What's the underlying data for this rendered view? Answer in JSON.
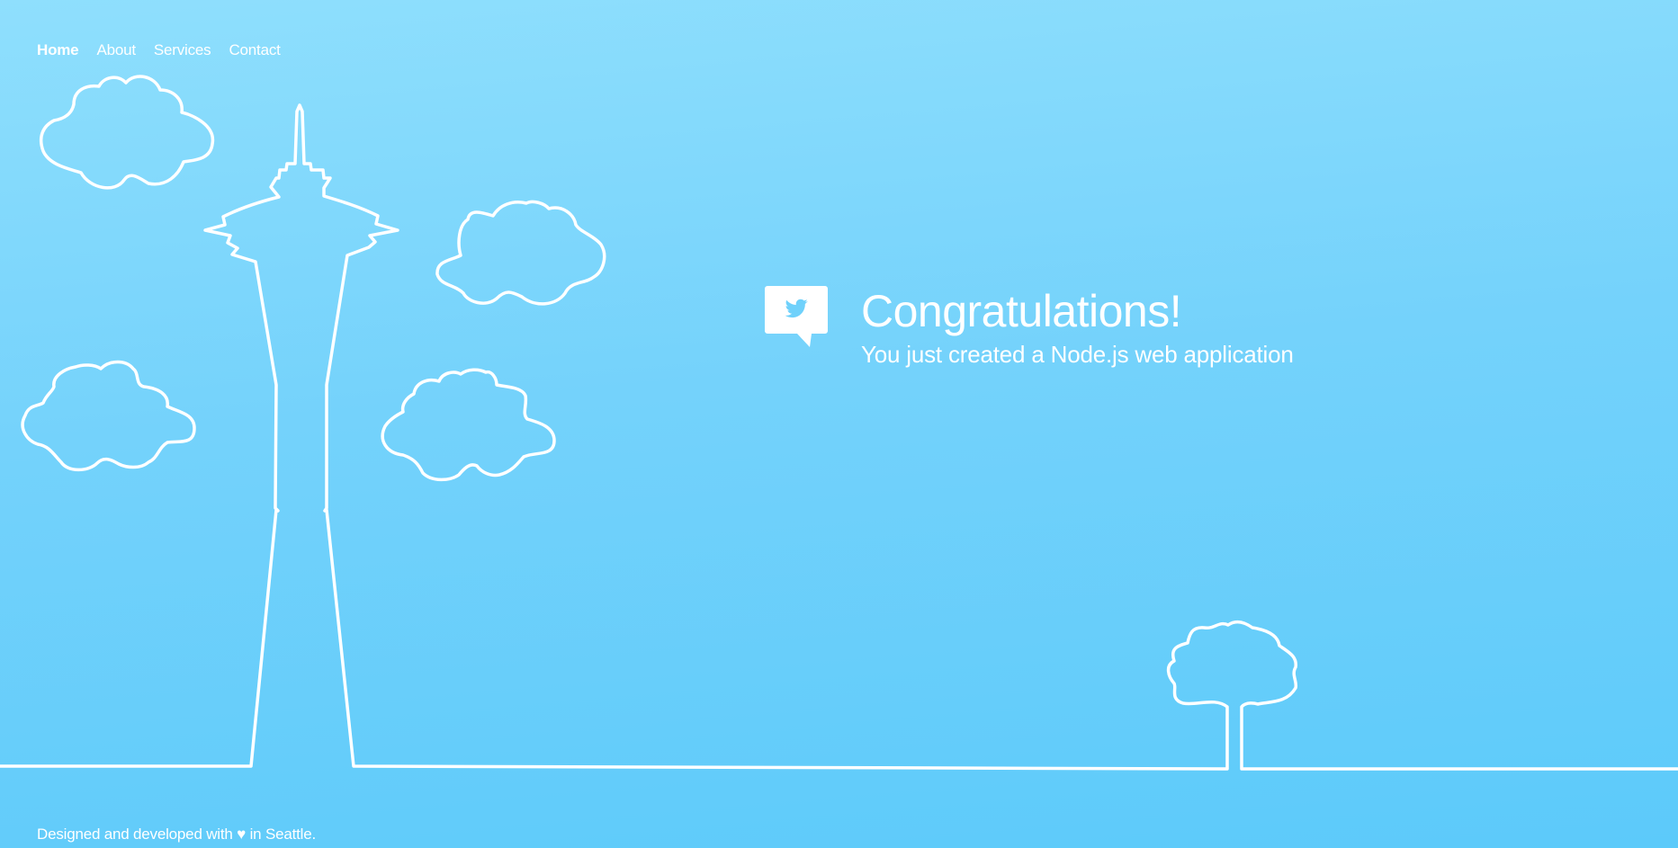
{
  "nav": {
    "items": [
      {
        "label": "Home",
        "active": true
      },
      {
        "label": "About",
        "active": false
      },
      {
        "label": "Services",
        "active": false
      },
      {
        "label": "Contact",
        "active": false
      }
    ]
  },
  "hero": {
    "icon": "twitter-bird-speech-bubble-icon",
    "title": "Congratulations!",
    "subtitle": "You just created a Node.js web application"
  },
  "footer": {
    "text": "Designed and developed with ♥ in Seattle."
  },
  "colors": {
    "sky_top": "#8fdffd",
    "sky_bottom": "#5ccafa",
    "line": "#ffffff"
  }
}
